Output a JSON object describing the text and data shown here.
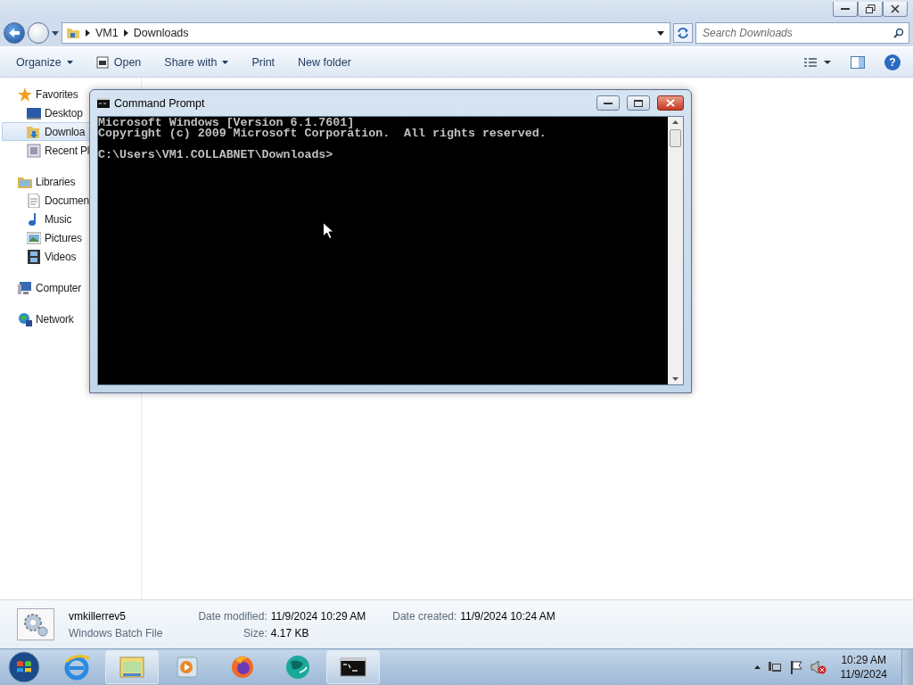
{
  "explorer": {
    "address": [
      "VM1",
      "Downloads"
    ],
    "search": {
      "placeholder": "Search Downloads"
    },
    "organize": {
      "label": "Organize",
      "dropdown": true
    },
    "toolbar": [
      {
        "label": "Open",
        "kind": "open",
        "dropdown": false
      },
      {
        "label": "Share with",
        "kind": "plain",
        "dropdown": true
      },
      {
        "label": "Print",
        "kind": "plain",
        "dropdown": false
      },
      {
        "label": "New folder",
        "kind": "plain",
        "dropdown": false
      }
    ],
    "help": "?",
    "nav": [
      {
        "label": "Favorites",
        "kind": "star",
        "children": [
          {
            "label": "Desktop",
            "kind": "desktop",
            "selected": false
          },
          {
            "label": "Downloa",
            "kind": "downloads",
            "selected": true
          },
          {
            "label": "Recent Pl",
            "kind": "recent",
            "selected": false
          }
        ]
      },
      {
        "label": "Libraries",
        "kind": "library",
        "children": [
          {
            "label": "Documen",
            "kind": "document",
            "selected": false
          },
          {
            "label": "Music",
            "kind": "music",
            "selected": false
          },
          {
            "label": "Pictures",
            "kind": "pictures",
            "selected": false
          },
          {
            "label": "Videos",
            "kind": "videos",
            "selected": false
          }
        ]
      },
      {
        "label": "Computer",
        "kind": "computer"
      },
      {
        "label": "Network",
        "kind": "network"
      }
    ],
    "details": {
      "name": "vmkillerrev5",
      "type": "Windows Batch File",
      "fields": [
        {
          "label": "Date modified:",
          "value": "11/9/2024 10:29 AM"
        },
        {
          "label": "Size:",
          "value": "4.17 KB"
        },
        {
          "label": "Date created:",
          "value": "11/9/2024 10:24 AM"
        }
      ]
    }
  },
  "cmd": {
    "title": "Command Prompt",
    "lines": [
      "Microsoft Windows [Version 6.1.7601]",
      "Copyright (c) 2009 Microsoft Corporation.  All rights reserved."
    ],
    "prompt": "C:\\Users\\VM1.COLLABNET\\Downloads>"
  },
  "taskbar": {
    "apps": [
      {
        "kind": "ie",
        "selected": false
      },
      {
        "kind": "explorer",
        "selected": true
      },
      {
        "kind": "media",
        "selected": false
      },
      {
        "kind": "firefox",
        "selected": false
      },
      {
        "kind": "globe",
        "selected": false
      },
      {
        "kind": "cmd",
        "selected": true
      }
    ],
    "time": "10:29 AM",
    "date": "11/9/2024"
  }
}
